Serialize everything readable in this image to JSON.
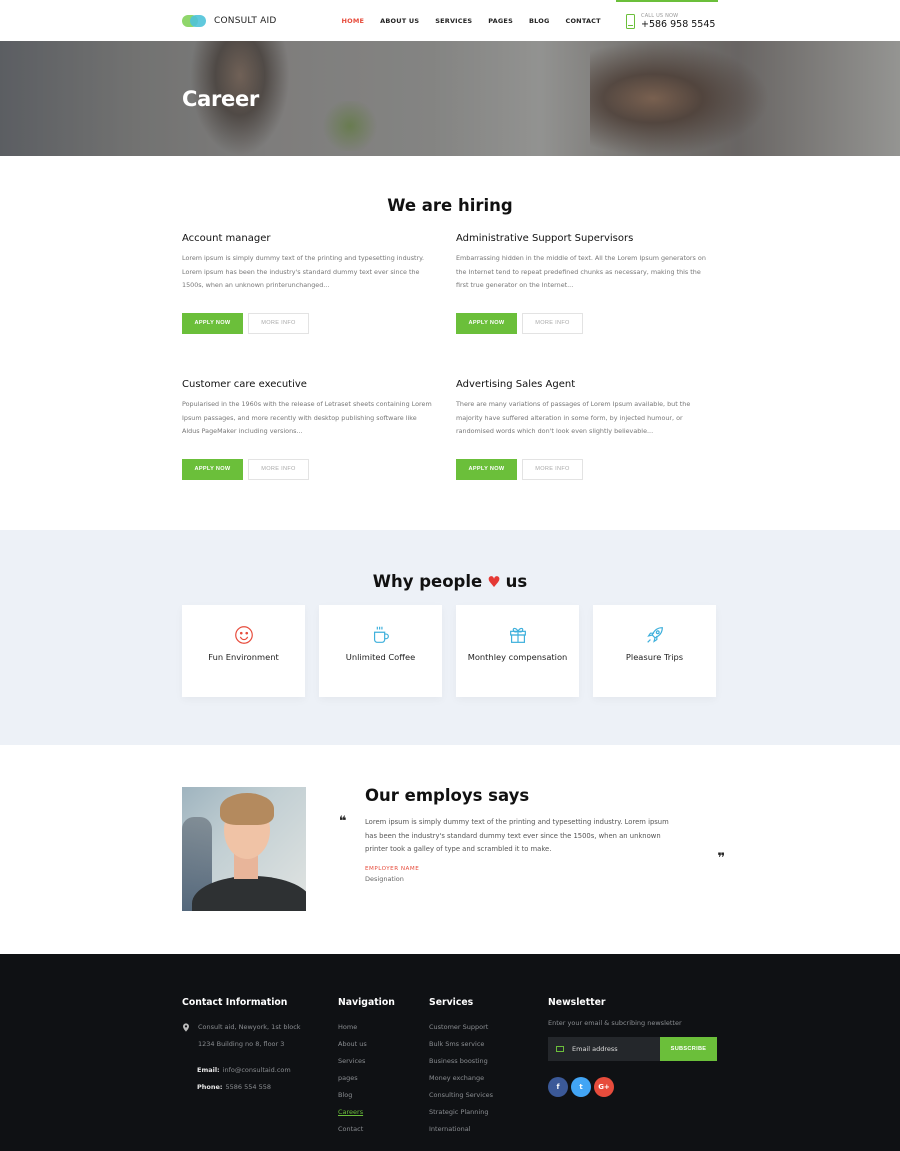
{
  "header": {
    "brand": "CONSULT AID",
    "nav": [
      {
        "label": "HOME",
        "active": true
      },
      {
        "label": "ABOUT US",
        "active": false
      },
      {
        "label": "SERVICES",
        "active": false
      },
      {
        "label": "PAGES",
        "active": false
      },
      {
        "label": "BLOG",
        "active": false
      },
      {
        "label": "CONTACT",
        "active": false
      }
    ],
    "call_label": "CALL US NOW",
    "call_number": "+586 958 5545"
  },
  "hero": {
    "title": "Career"
  },
  "hiring": {
    "title": "We are hiring",
    "jobs": [
      {
        "title": "Account manager",
        "desc": "Lorem ipsum is simply dummy text of the printing and typesetting industry. Lorem ipsum has been the industry's standard dummy text ever since the 1500s, when an unknown printerunchanged...",
        "apply": "APPLY NOW",
        "more": "MORE INFO"
      },
      {
        "title": "Administrative Support Supervisors",
        "desc": "Embarrassing hidden in the middle of text. All the Lorem Ipsum generators on the Internet tend to repeat predefined chunks as necessary, making this the first true generator on the Internet...",
        "apply": "APPLY NOW",
        "more": "MORE INFO"
      },
      {
        "title": "Customer care executive",
        "desc": "Popularised in the 1960s with the release of Letraset sheets containing Lorem Ipsum passages, and more recently with desktop publishing software like Aldus PageMaker including versions...",
        "apply": "APPLY NOW",
        "more": "MORE INFO"
      },
      {
        "title": "Advertising Sales Agent",
        "desc": "There are many variations of passages of Lorem Ipsum available, but the majority have suffered alteration in some form, by injected humour, or randomised words which don't look even slightly believable...",
        "apply": "APPLY NOW",
        "more": "MORE INFO"
      }
    ]
  },
  "why": {
    "title_before": "Why people",
    "title_icon": "heart-icon",
    "title_after": "us",
    "perks": [
      {
        "icon": "smiley-icon",
        "label": "Fun Environment",
        "color": "#e74c3c"
      },
      {
        "icon": "coffee-cup-icon",
        "label": "Unlimited Coffee",
        "color": "#3fb0dc"
      },
      {
        "icon": "gift-icon",
        "label": "Monthley compensation",
        "color": "#3fb0dc"
      },
      {
        "icon": "rocket-icon",
        "label": "Pleasure Trips",
        "color": "#3fb0dc"
      }
    ]
  },
  "testimonial": {
    "title": "Our employs says",
    "quote": "Lorem ipsum is simply dummy text of the printing and typesetting industry. Lorem ipsum has been the industry's standard dummy text ever since the 1500s, when an unknown printer took a galley of type and scrambled it to make.",
    "name": "EMPLOYER NAME",
    "designation": "Designation",
    "open_quote": "❝",
    "close_quote": "❞"
  },
  "footer": {
    "contact": {
      "title": "Contact Information",
      "address_line1": "Consult aid, Newyork, 1st block",
      "address_line2": "1234 Building no 8, floor 3",
      "email_label": "Email:",
      "email": "info@consultaid.com",
      "phone_label": "Phone:",
      "phone": "5586 554 558"
    },
    "navigation": {
      "title": "Navigation",
      "items": [
        "Home",
        "About us",
        "Services",
        "pages",
        "Blog",
        "Careers",
        "Contact"
      ],
      "current": "Careers"
    },
    "services": {
      "title": "Services",
      "items": [
        "Customer Support",
        "Bulk Sms service",
        "Business boosting",
        "Money exchange",
        "Consulting Services",
        "Strategic Planning",
        "International"
      ]
    },
    "newsletter": {
      "title": "Newsletter",
      "desc": "Enter your email & subcribing newsletter",
      "placeholder": "Email address",
      "button": "SUBSCRIBE",
      "social": [
        {
          "icon": "facebook-icon",
          "glyph": "f"
        },
        {
          "icon": "twitter-icon",
          "glyph": "t"
        },
        {
          "icon": "google-plus-icon",
          "glyph": "G+"
        }
      ]
    }
  },
  "colors": {
    "accent": "#6bbf3a",
    "active_nav": "#e74c3c",
    "heart": "#e53935",
    "footer_bg": "#0f1114",
    "why_bg": "#edf1f7"
  }
}
